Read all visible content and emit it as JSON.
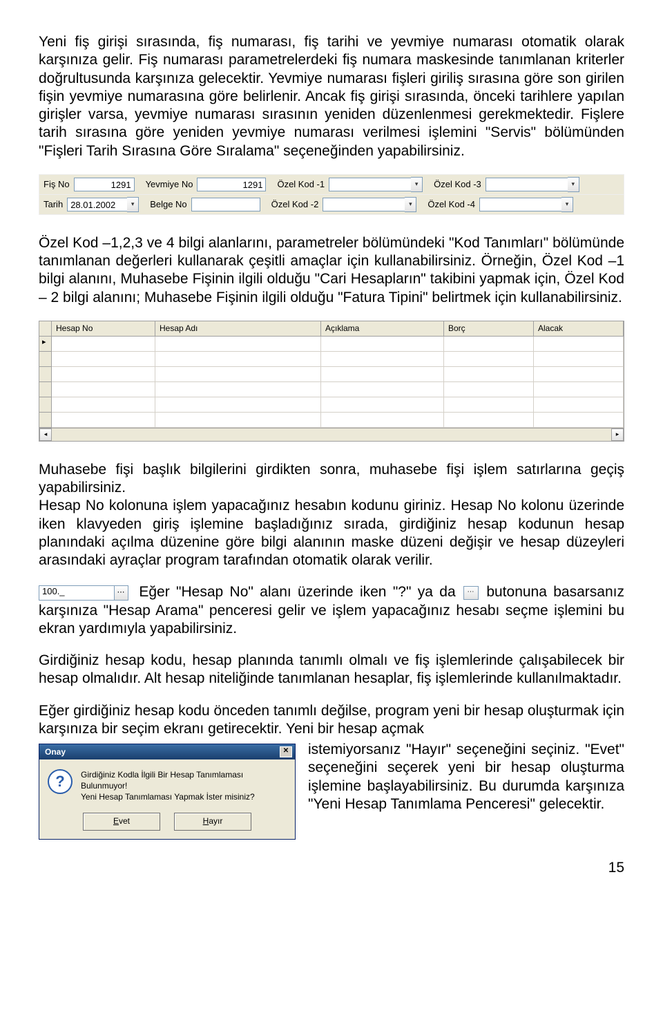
{
  "para1": "Yeni fiş girişi sırasında, fiş numarası, fiş tarihi ve yevmiye numarası otomatik olarak karşınıza gelir. Fiş numarası parametrelerdeki fiş numara maskesinde tanımlanan kriterler doğrultusunda karşınıza gelecektir. Yevmiye numarası fişleri giriliş sırasına göre son girilen fişin yevmiye numarasına göre belirlenir. Ancak fiş girişi sırasında, önceki tarihlere yapılan girişler varsa, yevmiye numarası sırasının yeniden düzenlenmesi gerekmektedir. Fişlere tarih sırasına göre yeniden yevmiye numarası verilmesi işlemini \"Servis\" bölümünden \"Fişleri Tarih Sırasına Göre Sıralama\" seçeneğinden yapabilirsiniz.",
  "form": {
    "fisno_label": "Fiş No",
    "fisno_value": "1291",
    "yevmiye_label": "Yevmiye No",
    "yevmiye_value": "1291",
    "ozel1_label": "Özel Kod -1",
    "ozel3_label": "Özel Kod -3",
    "tarih_label": "Tarih",
    "tarih_value": "28.01.2002",
    "belge_label": "Belge No",
    "ozel2_label": "Özel Kod -2",
    "ozel4_label": "Özel Kod -4"
  },
  "para2": "Özel Kod –1,2,3 ve 4 bilgi alanlarını, parametreler bölümündeki \"Kod Tanımları\" bölümünde tanımlanan değerleri kullanarak çeşitli amaçlar için kullanabilirsiniz. Örneğin, Özel Kod –1 bilgi alanını, Muhasebe Fişinin ilgili olduğu \"Cari Hesapların\" takibini yapmak için, Özel Kod – 2 bilgi alanını; Muhasebe Fişinin ilgili olduğu \"Fatura Tipini\" belirtmek için kullanabilirsiniz.",
  "grid": {
    "h1": "Hesap No",
    "h2": "Hesap Adı",
    "h3": "Açıklama",
    "h4": "Borç",
    "h5": "Alacak"
  },
  "para3": "Muhasebe fişi başlık bilgilerini girdikten sonra, muhasebe fişi işlem satırlarına geçiş yapabilirsiniz.\nHesap No kolonuna işlem yapacağınız hesabın kodunu giriniz. Hesap No kolonu üzerinde iken klavyeden giriş işlemine başladığınız sırada, girdiğiniz hesap kodunun hesap planındaki açılma düzenine göre bilgi alanının maske düzeni değişir ve hesap düzeyleri arasındaki ayraçlar program tarafından otomatik olarak verilir.",
  "hesap_value": "100._",
  "para4a": "Eğer \"Hesap No\" alanı üzerinde iken \"?\" ya da ",
  "para4b": " butonuna basarsanız karşınıza \"Hesap Arama\" penceresi gelir ve işlem yapacağınız hesabı seçme işlemini bu ekran yardımıyla yapabilirsiniz.",
  "para5": "Girdiğiniz hesap kodu, hesap planında tanımlı olmalı ve fiş işlemlerinde çalışabilecek bir hesap olmalıdır. Alt hesap niteliğinde tanımlanan hesaplar, fiş işlemlerinde kullanılmaktadır.",
  "para6": "Eğer girdiğiniz hesap kodu önceden tanımlı değilse, program yeni bir hesap oluşturmak için karşınıza bir seçim ekranı getirecektir. Yeni bir hesap açmak",
  "dialog": {
    "title": "Onay",
    "line1": "Girdiğiniz Kodla İlgili Bir Hesap Tanımlaması Bulunmuyor!",
    "line2": "Yeni Hesap Tanımlaması Yapmak İster misiniz?",
    "yes": "Evet",
    "no": "Hayır"
  },
  "para7": "istemiyorsanız \"Hayır\" seçeneğini seçiniz. \"Evet\" seçeneğini seçerek yeni bir hesap oluşturma işlemine başlayabilirsiniz. Bu durumda karşınıza \"Yeni Hesap Tanımlama Penceresi\" gelecektir.",
  "page": "15"
}
